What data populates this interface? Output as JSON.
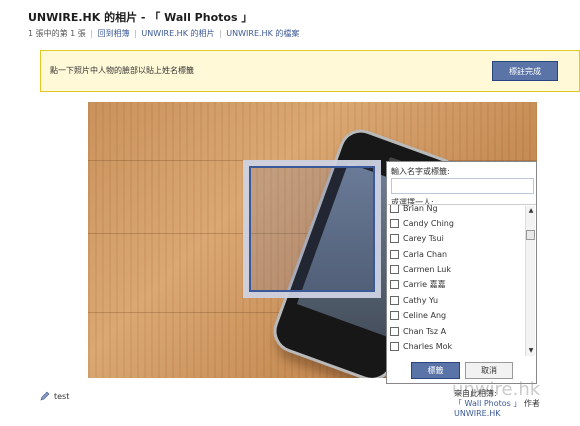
{
  "header": {
    "title": "UNWIRE.HK 的相片 - 「 Wall Photos 」",
    "position_text": "1 張中的第 1 張",
    "links": [
      "回到相簿",
      "UNWIRE.HK 的相片",
      "UNWIRE.HK 的檔案"
    ]
  },
  "notice": {
    "text": "點一下照片中人物的臉部以貼上姓名標籤",
    "done_label": "標註完成"
  },
  "photo": {
    "alt_subject": "phone"
  },
  "tag_panel": {
    "input_label": "輸入名字或標籤:",
    "input_value": "",
    "list_label": "或選擇一人:",
    "friends": [
      "Brian Ng",
      "Candy Ching",
      "Carey Tsui",
      "Carla Chan",
      "Carmen Luk",
      "Carrie 嘉嘉",
      "Cathy Yu",
      "Celine Ang",
      "Chan Tsz A",
      "Charles Mok"
    ],
    "tag_button": "標籤",
    "cancel_button": "取消"
  },
  "caption": {
    "text": "test"
  },
  "source": {
    "label": "來自此相簿:",
    "album_link": "「 Wall Photos 」",
    "by": "作者",
    "author_link": "UNWIRE.HK",
    "watermark": "unwire.hk"
  },
  "colors": {
    "link": "#3b5998",
    "button": "#5b74a8",
    "notice_bg": "#fff9d7"
  }
}
